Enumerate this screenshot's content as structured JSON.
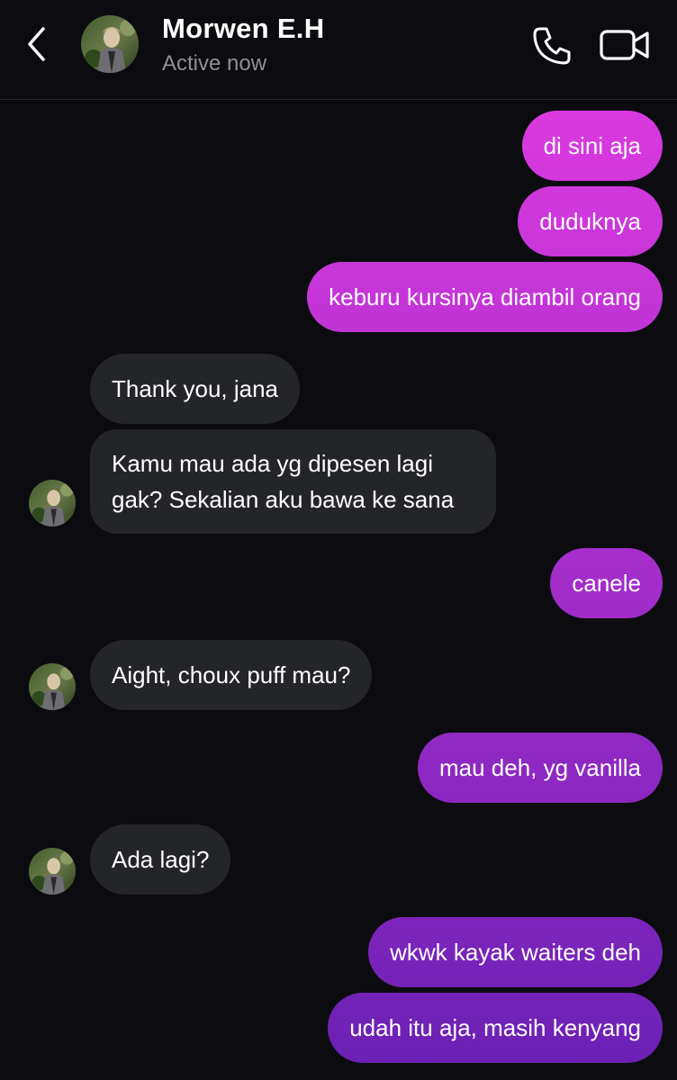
{
  "header": {
    "contact_name": "Morwen E.H",
    "status": "Active now",
    "icons": {
      "back": "chevron-left-icon",
      "call": "phone-icon",
      "video": "video-camera-icon"
    }
  },
  "colors": {
    "background": "#0c0c10",
    "incoming_bubble": "#242529",
    "outgoing_gradient_top": "#db3ae0",
    "outgoing_gradient_bottom": "#6a20b4",
    "status_text": "#8f8f96"
  },
  "messages": [
    {
      "direction": "outgoing",
      "text": "di sini aja"
    },
    {
      "direction": "outgoing",
      "text": "duduknya"
    },
    {
      "direction": "outgoing",
      "text": "keburu kursinya diambil orang"
    },
    {
      "direction": "incoming",
      "text": "Thank you, jana"
    },
    {
      "direction": "incoming",
      "text": "Kamu mau ada yg dipesen lagi gak? Sekalian aku bawa ke sana",
      "show_avatar": true
    },
    {
      "direction": "outgoing",
      "text": "canele"
    },
    {
      "direction": "incoming",
      "text": "Aight, choux puff mau?",
      "show_avatar": true
    },
    {
      "direction": "outgoing",
      "text": "mau deh, yg vanilla"
    },
    {
      "direction": "incoming",
      "text": "Ada lagi?",
      "show_avatar": true
    },
    {
      "direction": "outgoing",
      "text": "wkwk kayak waiters deh"
    },
    {
      "direction": "outgoing",
      "text": "udah itu aja, masih kenyang"
    }
  ]
}
